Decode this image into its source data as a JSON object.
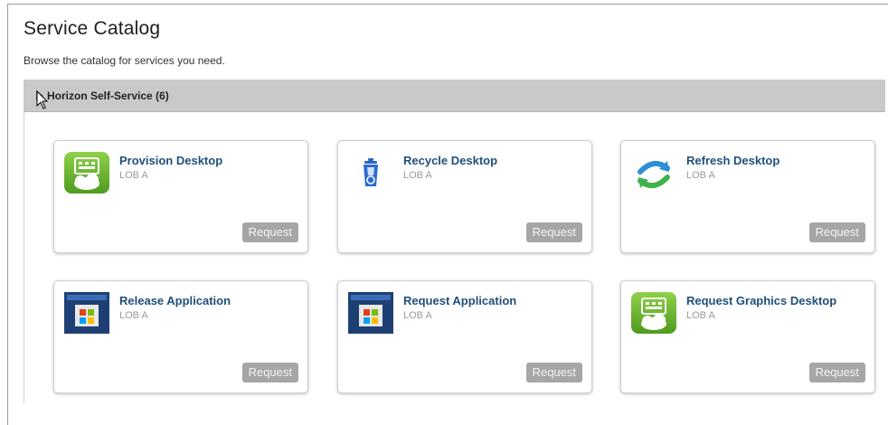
{
  "page": {
    "title": "Service Catalog",
    "subtitle": "Browse the catalog for services you need."
  },
  "group": {
    "title": "Horizon Self-Service (6)"
  },
  "cards": [
    {
      "title": "Provision Desktop",
      "subtitle": "LOB A",
      "button": "Request",
      "icon": "desktop-cloud-icon"
    },
    {
      "title": "Recycle Desktop",
      "subtitle": "LOB A",
      "button": "Request",
      "icon": "recycle-bin-icon"
    },
    {
      "title": "Refresh Desktop",
      "subtitle": "LOB A",
      "button": "Request",
      "icon": "refresh-icon"
    },
    {
      "title": "Release Application",
      "subtitle": "LOB A",
      "button": "Request",
      "icon": "application-icon"
    },
    {
      "title": "Request Application",
      "subtitle": "LOB A",
      "button": "Request",
      "icon": "application-icon"
    },
    {
      "title": "Request Graphics Desktop",
      "subtitle": "LOB A",
      "button": "Request",
      "icon": "desktop-cloud-icon"
    }
  ],
  "colors": {
    "group_header_bg": "#c9c9c9",
    "card_title": "#1f4f7a",
    "button_bg": "#a6a6a6",
    "desktop_icon_green": "#6bb02d",
    "app_icon_blue": "#1d3f73"
  }
}
